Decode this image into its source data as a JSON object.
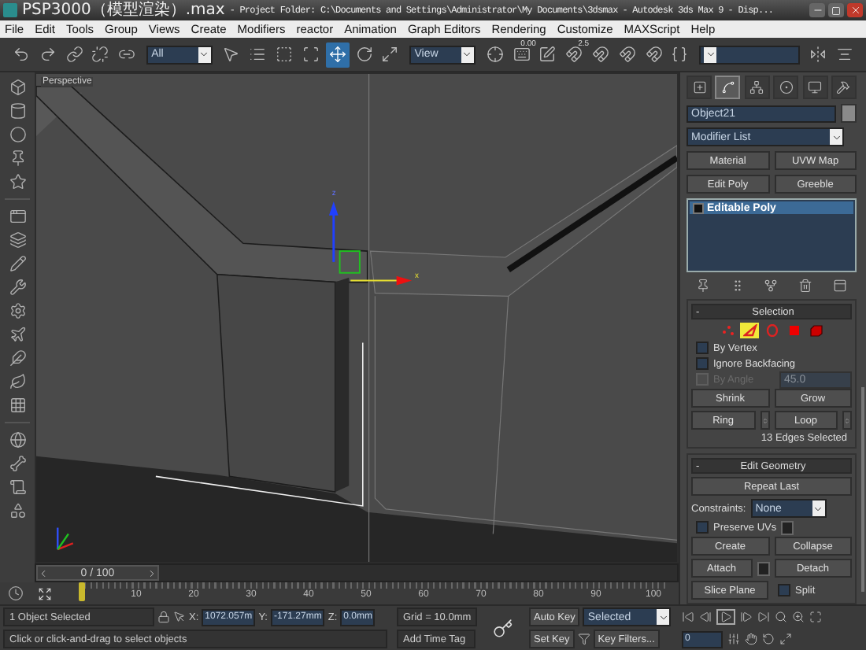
{
  "window": {
    "title_parts": [
      "PSP3000（模型渲染）.max",
      "- Project Folder: C:\\Documents and Settings\\Administrator\\My Documents\\3dsmax",
      "- Autodesk 3ds Max 9",
      "- Disp..."
    ]
  },
  "menu": [
    "File",
    "Edit",
    "Tools",
    "Group",
    "Views",
    "Create",
    "Modifiers",
    "reactor",
    "Animation",
    "Graph Editors",
    "Rendering",
    "Customize",
    "MAXScript",
    "Help"
  ],
  "main_toolbar": [
    {
      "kind": "tool",
      "selected": false
    },
    {
      "kind": "tool",
      "selected": false
    },
    {
      "kind": "tool",
      "selected": false
    },
    {
      "kind": "tool",
      "selected": false
    },
    {
      "kind": "tool",
      "selected": false
    },
    {
      "kind": "dropdown",
      "value": "All"
    },
    {
      "kind": "tool",
      "selected": false
    },
    {
      "kind": "tool",
      "selected": false
    },
    {
      "kind": "tool",
      "selected": false
    },
    {
      "kind": "tool",
      "selected": false
    },
    {
      "kind": "tool",
      "selected": true
    },
    {
      "kind": "tool",
      "selected": false
    },
    {
      "kind": "tool",
      "selected": false
    },
    {
      "kind": "dropdown",
      "value": "View"
    },
    {
      "kind": "tool",
      "selected": false
    },
    {
      "kind": "tool",
      "selected": false,
      "badge": "0.00"
    },
    {
      "kind": "tool",
      "selected": false
    },
    {
      "kind": "tool",
      "selected": false,
      "badge": "2.5"
    },
    {
      "kind": "tool",
      "selected": false
    },
    {
      "kind": "tool",
      "selected": false
    },
    {
      "kind": "tool",
      "selected": false
    },
    {
      "kind": "tool",
      "selected": false
    },
    {
      "kind": "dropdown"
    },
    {
      "kind": "tool",
      "selected": false
    },
    {
      "kind": "tool",
      "selected": false
    }
  ],
  "viewport": {
    "label": "Perspective",
    "axis_labels": [
      "z",
      "x"
    ]
  },
  "command_panel": {
    "tabs": [
      {
        "selected": false
      },
      {
        "selected": true
      },
      {
        "selected": false
      },
      {
        "selected": false
      },
      {
        "selected": false
      },
      {
        "selected": false
      }
    ],
    "object_name": "Object21",
    "modifier_list": "Modifier List",
    "modifier_buttons": [
      "Material",
      "UVW Map",
      "Edit Poly",
      "Greeble"
    ],
    "stack": [
      {
        "label": "Editable Poly",
        "selected": true
      }
    ],
    "selection": {
      "title": "Selection",
      "collapse_sign": "-",
      "levels": [
        {
          "selected": false
        },
        {
          "selected": true
        },
        {
          "selected": false
        },
        {
          "selected": false
        },
        {
          "selected": false
        }
      ],
      "checks": [
        {
          "label": "By Vertex",
          "checked": false,
          "disabled": false
        },
        {
          "label": "Ignore Backfacing",
          "checked": false,
          "disabled": false
        },
        {
          "label": "By Angle",
          "checked": false,
          "disabled": true
        }
      ],
      "angle_value": "45.0",
      "buttons": [
        {
          "label": "Shrink",
          "spinner": false
        },
        {
          "label": "Grow",
          "spinner": false
        },
        {
          "label": "Ring",
          "spinner": true
        },
        {
          "label": "Loop",
          "spinner": true
        }
      ],
      "status": "13 Edges Selected"
    },
    "edit_geometry": {
      "title": "Edit Geometry",
      "collapse_sign": "-",
      "repeat_last": "Repeat Last",
      "constraints_label": "Constraints:",
      "constraints_value": "None",
      "preserve_uvs": {
        "label": "Preserve UVs",
        "checked": false
      },
      "buttons": [
        {
          "label": "Create",
          "settings": false
        },
        {
          "label": "Collapse",
          "settings": false
        },
        {
          "label": "Attach",
          "settings": true
        },
        {
          "label": "Detach",
          "settings": false
        }
      ],
      "slice_plane": "Slice Plane",
      "split": {
        "label": "Split",
        "checked": false
      }
    }
  },
  "timeline": {
    "position": "0 / 100",
    "level": 0,
    "ticks": [
      "10",
      "20",
      "30",
      "40",
      "50",
      "60",
      "70",
      "80",
      "90",
      "100"
    ]
  },
  "status_bar": {
    "selection": "1 Object Selected",
    "coords": [
      {
        "axis": "X:",
        "value": "1072.057m"
      },
      {
        "axis": "Y:",
        "value": "-171.27mm"
      },
      {
        "axis": "Z:",
        "value": "0.0mm"
      }
    ],
    "grid": "Grid = 10.0mm",
    "prompt": "Click or click-and-drag to select objects",
    "time_tag": "Add Time Tag"
  },
  "animation": {
    "auto_key": "Auto Key",
    "key_mode": "Selected",
    "set_key": "Set Key",
    "key_filters": "Key Filters...",
    "frame": "0"
  }
}
